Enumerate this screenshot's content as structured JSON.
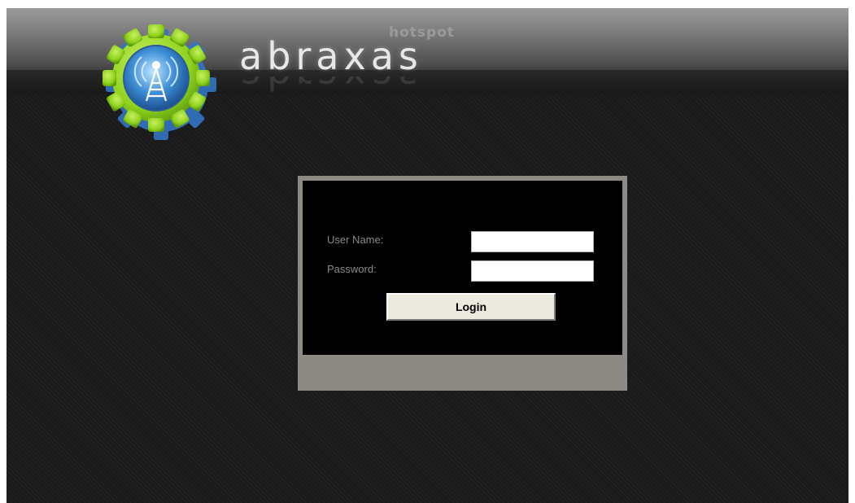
{
  "header": {
    "brand_name": "abraxas",
    "brand_tagline": "hotspot",
    "logo_icon": "gear-antenna-logo-icon"
  },
  "login": {
    "username_label": "User Name:",
    "username_value": "",
    "password_label": "Password:",
    "password_value": "",
    "submit_label": "Login"
  },
  "colors": {
    "gear_green": "#8fd21e",
    "gear_blue": "#3d8fd6",
    "frame_gray": "#8d8a83",
    "panel_black": "#000000",
    "button_bg": "#ece9de"
  }
}
